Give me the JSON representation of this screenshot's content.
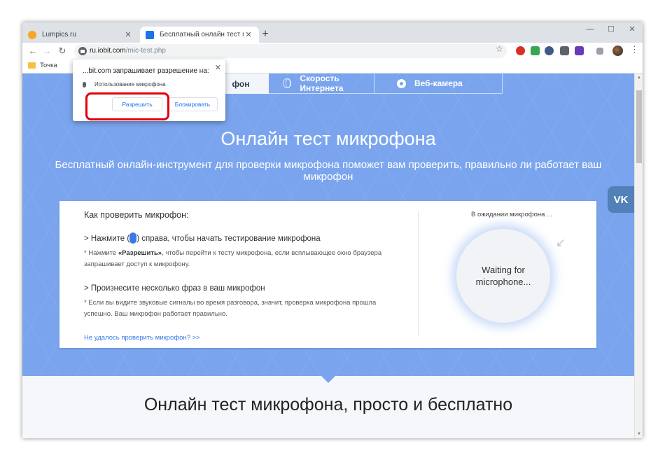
{
  "browser": {
    "tabs": [
      {
        "title": "Lumpics.ru",
        "favicon_color": "#f5a623",
        "active": false
      },
      {
        "title": "Бесплатный онлайн тест микрофона",
        "favicon_color": "#1a73e8",
        "active": true
      }
    ],
    "new_tab_symbol": "+",
    "window_controls": {
      "minimize": "—",
      "maximize": "☐",
      "close": "✕"
    },
    "url_domain": "ru.iobit.com",
    "url_path": "/mic-test.php",
    "bookmark": "Точка"
  },
  "permission_popup": {
    "title": "...bit.com запрашивает разрешение на:",
    "permission": "Использование микрофона",
    "allow_label": "Разрешить",
    "block_label": "Блокировать",
    "highlight_color": "#e3000b"
  },
  "site": {
    "nav_tabs": [
      "фон",
      "Скорость Интернета",
      "Веб-камера"
    ],
    "hero_title": "Онлайн тест микрофона",
    "hero_subtitle": "Бесплатный онлайн-инструмент для проверки микрофона поможет вам проверить, правильно ли работает ваш микрофон",
    "vk_label": "VK",
    "card": {
      "how_title": "Как проверить микрофон:",
      "step1_pre": "> Нажмите (",
      "step1_post": ") справа, чтобы начать тестирование микрофона",
      "note1_pre": "* Нажмите ",
      "note1_bold": "«Разрешить»",
      "note1_post": ", чтобы перейти к тесту микрофона, если всплывающее окно браузера запрашивает доступ к микрофону.",
      "step2": "> Произнесите несколько фраз в ваш микрофон",
      "note2": "* Если вы видите звуковые сигналы во время разговора, значит, проверка микрофона прошла успешно. Ваш микрофон работает правильно.",
      "fail_link": "Не удалось проверить микрофон? >>",
      "waiting_label": "В ожидании микрофона ...",
      "waiting_text": "Waiting for microphone..."
    },
    "section_title": "Онлайн тест микрофона, просто и бесплатно",
    "accent_color": "#7aa5ee"
  }
}
